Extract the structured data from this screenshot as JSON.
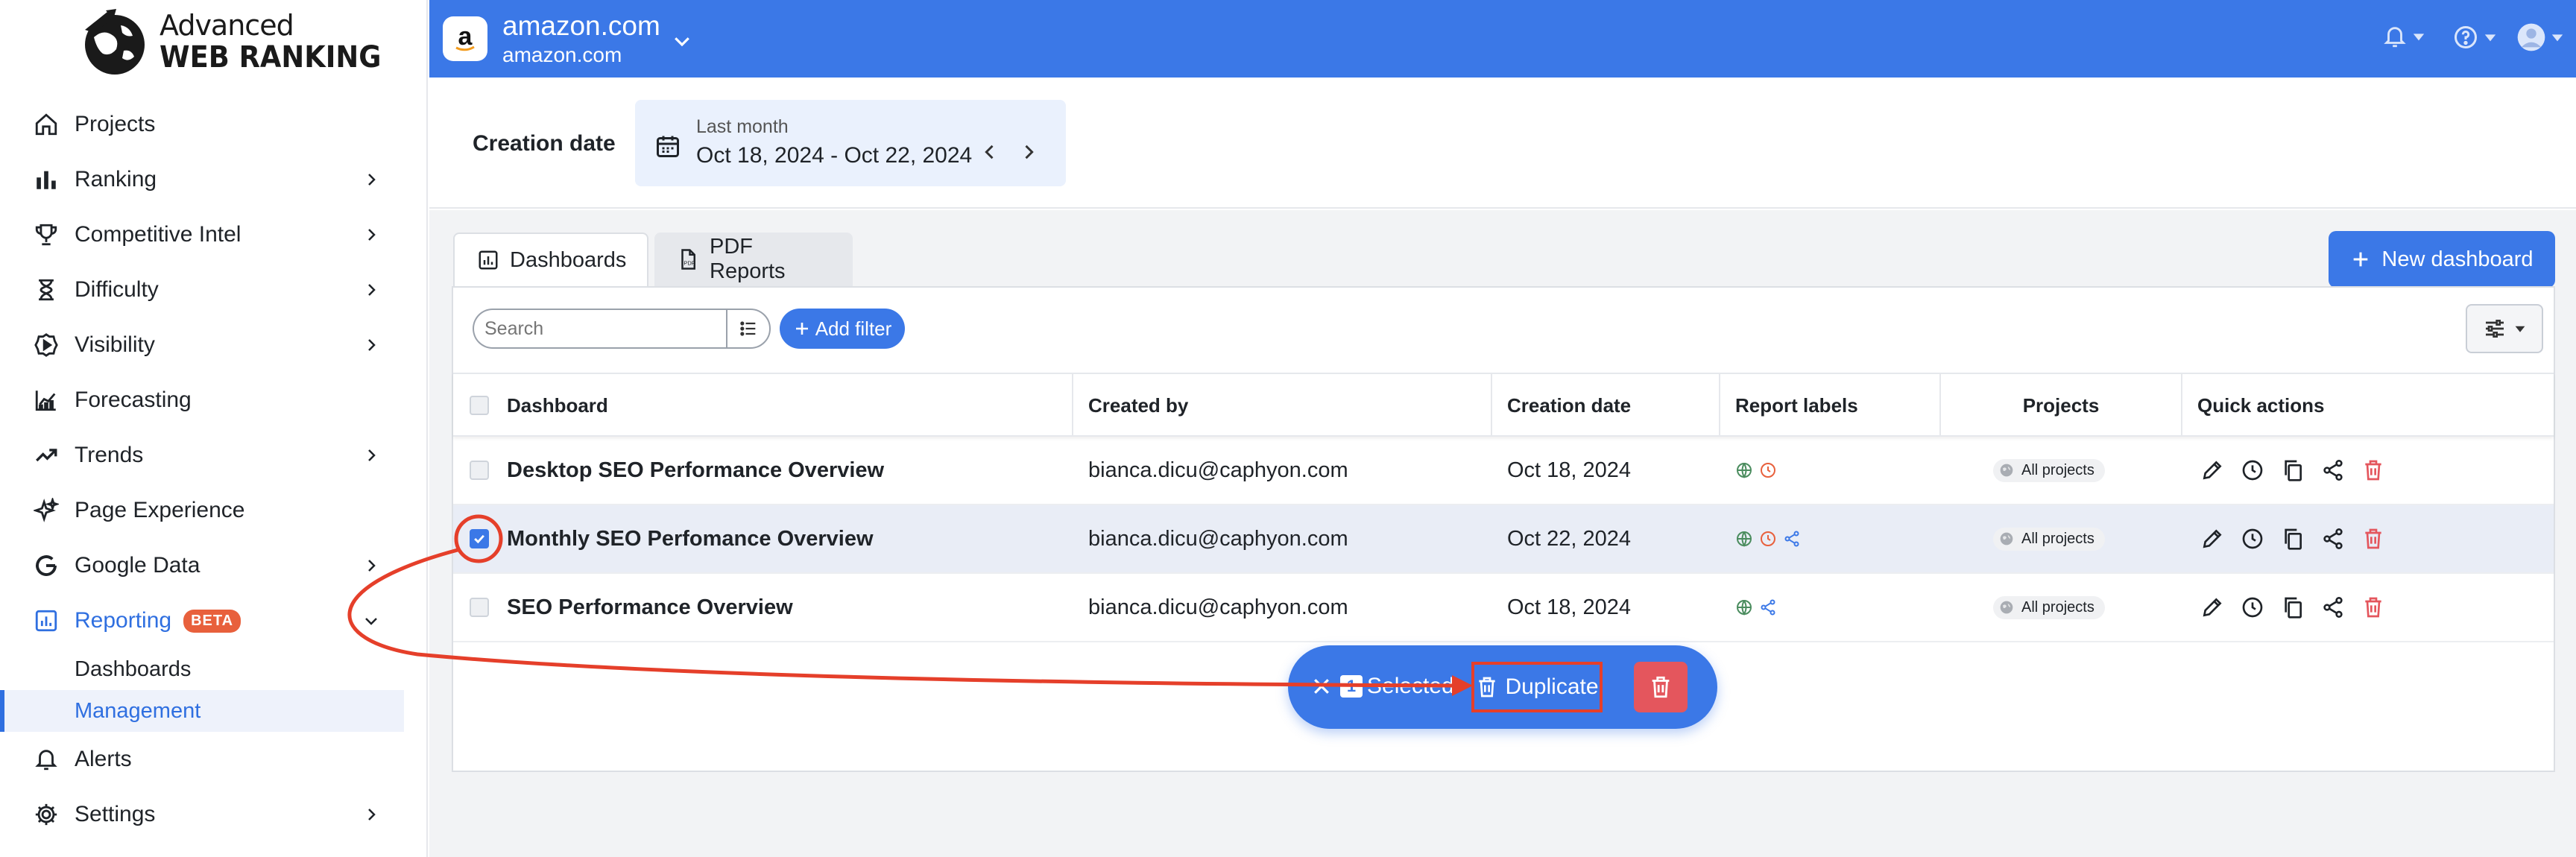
{
  "logo": {
    "line1": "Advanced",
    "line2": "WEB RANKING"
  },
  "sidebar": {
    "items": [
      {
        "label": "Projects",
        "icon": "home-icon",
        "chevron": false
      },
      {
        "label": "Ranking",
        "icon": "bar-chart-icon",
        "chevron": true
      },
      {
        "label": "Competitive Intel",
        "icon": "trophy-icon",
        "chevron": true
      },
      {
        "label": "Difficulty",
        "icon": "hourglass-icon",
        "chevron": true
      },
      {
        "label": "Visibility",
        "icon": "visibility-gear-icon",
        "chevron": true
      },
      {
        "label": "Forecasting",
        "icon": "forecast-chart-icon",
        "chevron": false
      },
      {
        "label": "Trends",
        "icon": "trend-line-icon",
        "chevron": true
      },
      {
        "label": "Page Experience",
        "icon": "sparkle-icon",
        "chevron": false
      },
      {
        "label": "Google Data",
        "icon": "google-icon",
        "chevron": true
      },
      {
        "label": "Reporting",
        "icon": "report-icon",
        "chevron": true,
        "badge": "BETA",
        "active": true
      }
    ],
    "reporting_sub": [
      {
        "label": "Dashboards",
        "active": false
      },
      {
        "label": "Management",
        "active": true
      }
    ],
    "bottom_items": [
      {
        "label": "Alerts",
        "icon": "bell-icon",
        "chevron": false
      },
      {
        "label": "Settings",
        "icon": "gear-icon",
        "chevron": true
      }
    ]
  },
  "topbar": {
    "site_title": "amazon.com",
    "site_sub": "amazon.com",
    "badge_letter": "a"
  },
  "filter": {
    "label": "Creation date",
    "period": "Last month",
    "range": "Oct 18, 2024 - Oct 22, 2024"
  },
  "tabs": [
    {
      "label": "Dashboards",
      "active": true
    },
    {
      "label": "PDF Reports",
      "active": false
    }
  ],
  "new_dashboard_label": "New dashboard",
  "search": {
    "placeholder": "Search",
    "value": ""
  },
  "add_filter_label": "Add filter",
  "table": {
    "headers": [
      "Dashboard",
      "Created by",
      "Creation date",
      "Report labels",
      "Projects",
      "Quick actions"
    ],
    "rows": [
      {
        "name": "Desktop SEO Performance Overview",
        "created_by": "bianca.dicu@caphyon.com",
        "date": "Oct 18, 2024",
        "labels": [
          "globe",
          "clock"
        ],
        "projects": "All projects",
        "checked": false
      },
      {
        "name": "Monthly SEO Perfomance Overview",
        "created_by": "bianca.dicu@caphyon.com",
        "date": "Oct 22, 2024",
        "labels": [
          "globe",
          "clock",
          "share"
        ],
        "projects": "All projects",
        "checked": true
      },
      {
        "name": "SEO Performance Overview",
        "created_by": "bianca.dicu@caphyon.com",
        "date": "Oct 18, 2024",
        "labels": [
          "globe",
          "share"
        ],
        "projects": "All projects",
        "checked": false
      }
    ]
  },
  "bulk": {
    "count": "1",
    "selected_label": "Selected",
    "duplicate_label": "Duplicate"
  },
  "colors": {
    "accent": "#3b78e7",
    "danger": "#e4565d",
    "annotation": "#e53f2a",
    "label_globe": "#4a8c5e",
    "label_clock": "#e8603c",
    "label_share": "#3b78e7"
  }
}
